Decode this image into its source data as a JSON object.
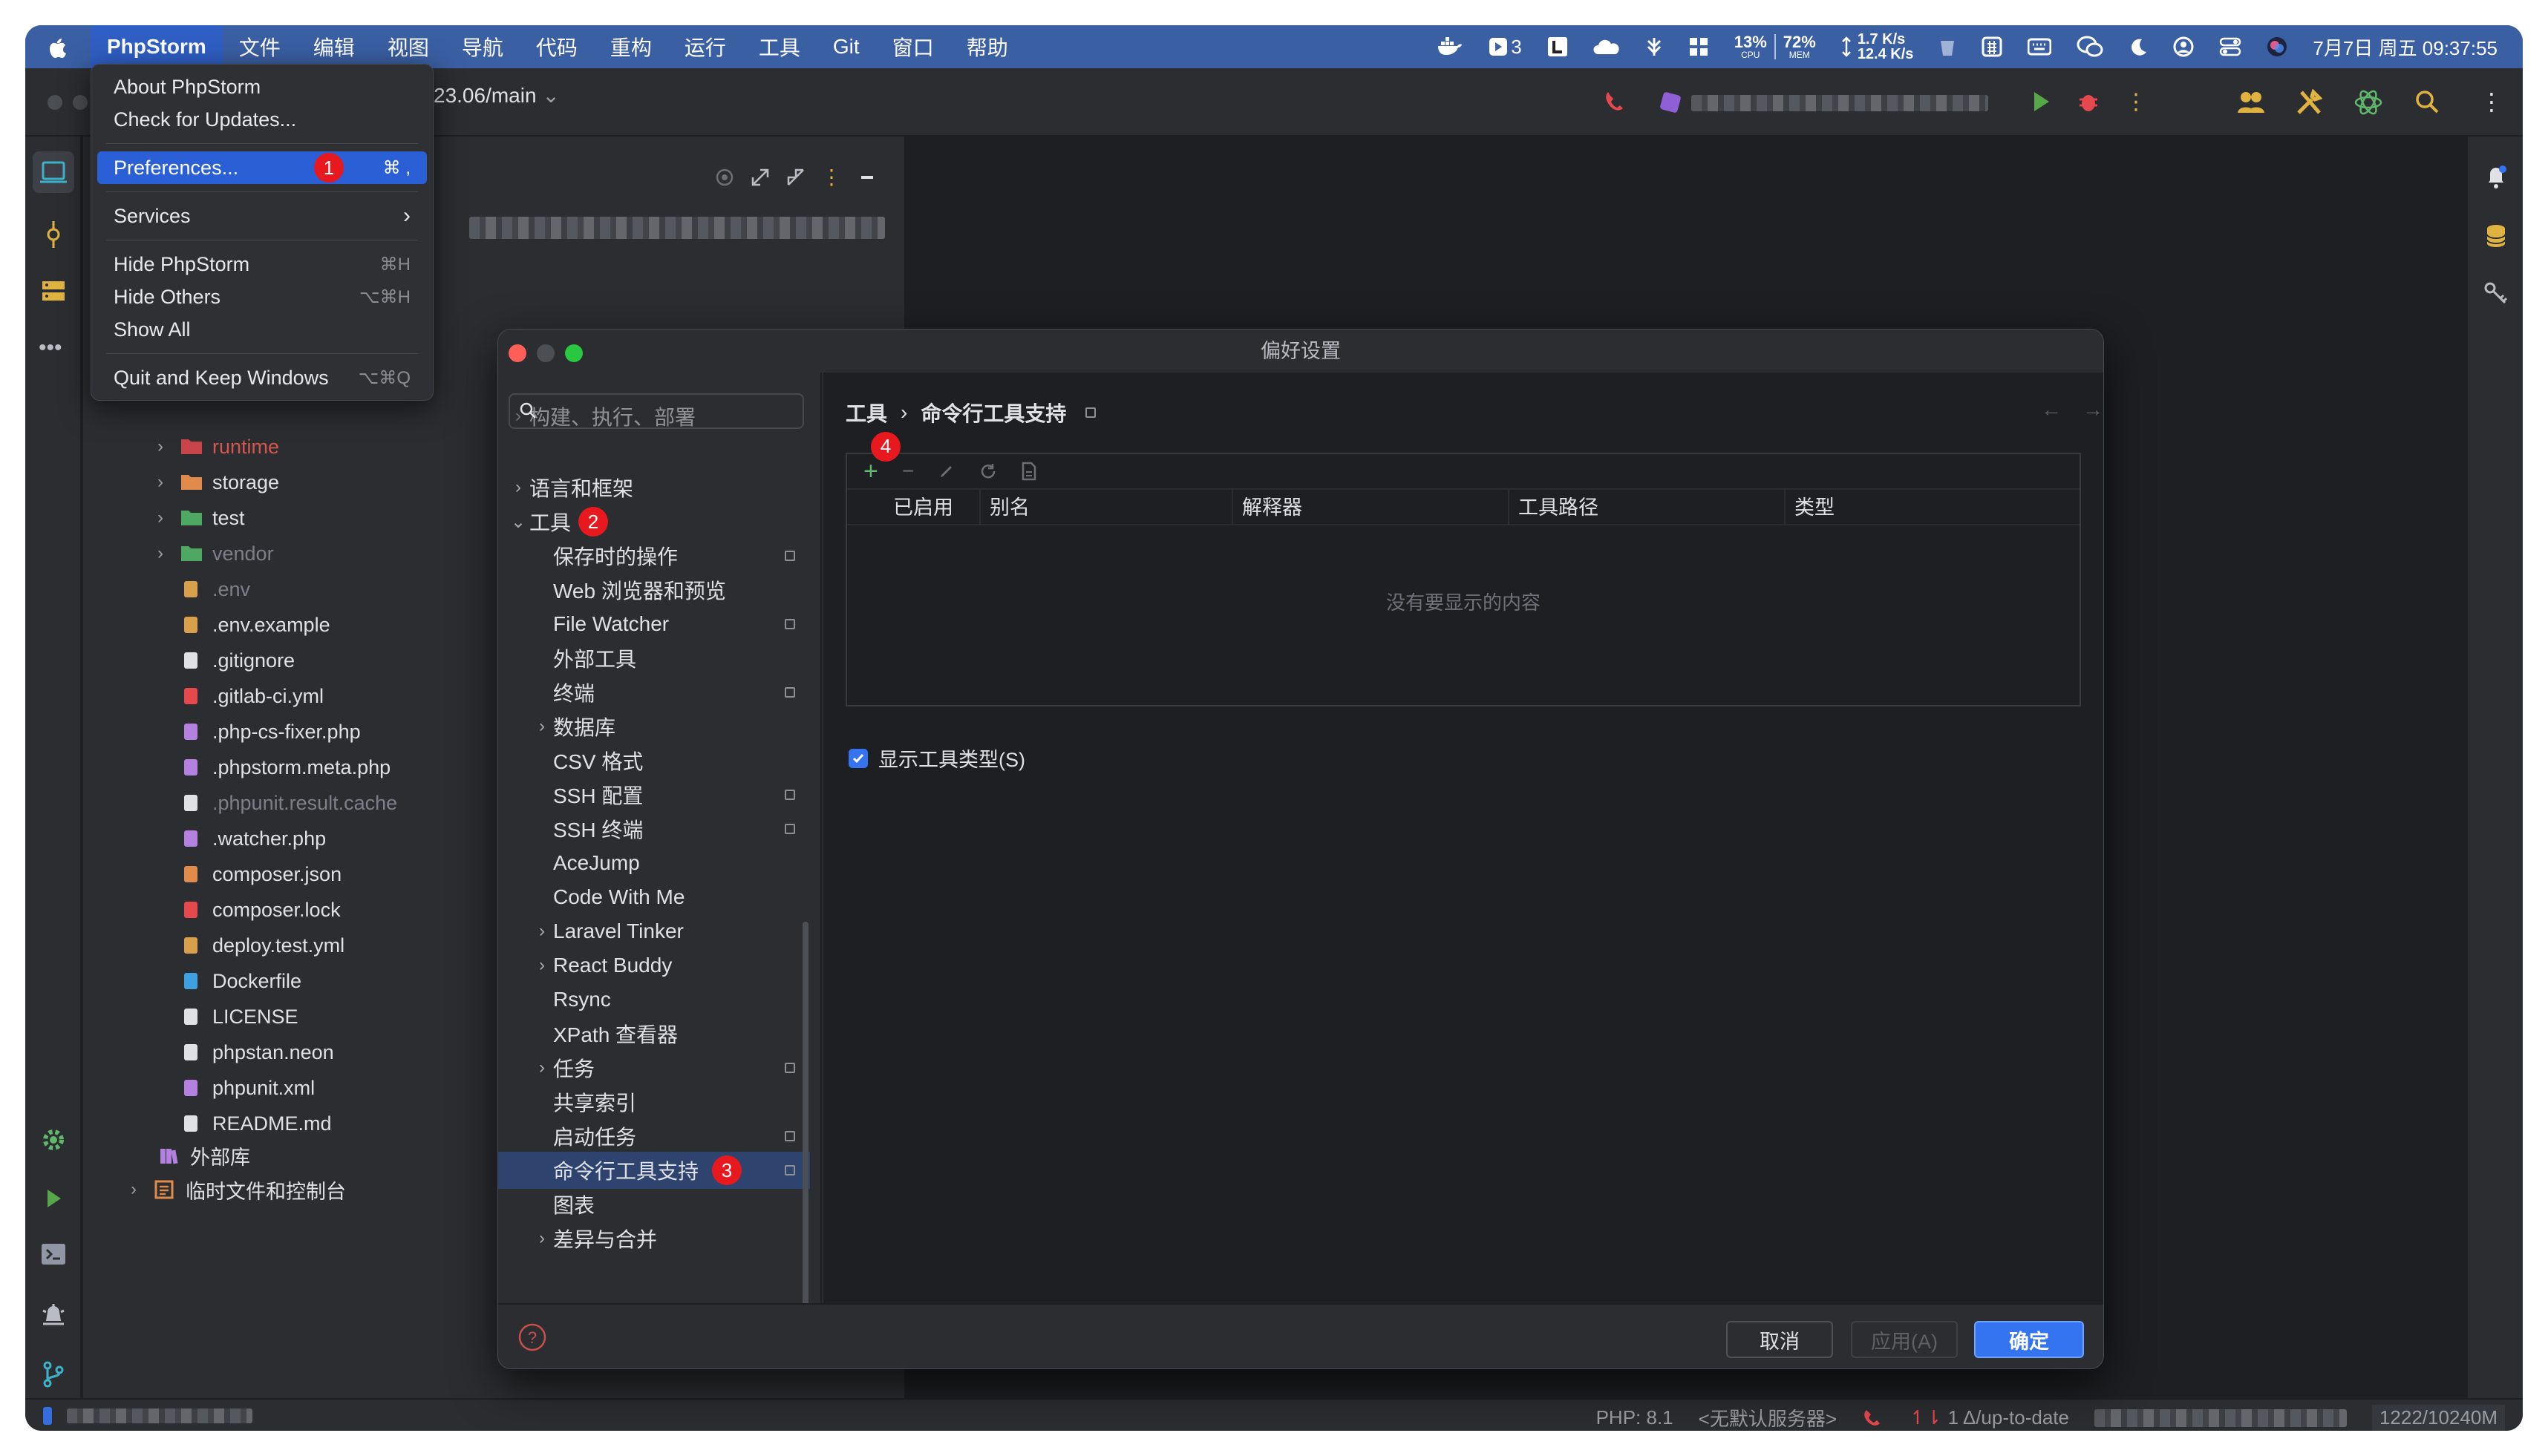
{
  "menubar": {
    "app_name": "PhpStorm",
    "items": [
      "文件",
      "编辑",
      "视图",
      "导航",
      "代码",
      "重构",
      "运行",
      "工具",
      "Git",
      "窗口",
      "帮助"
    ],
    "docker_count": "3",
    "cpu": {
      "value": "13%",
      "label": "CPU"
    },
    "mem": {
      "value": "72%",
      "label": "MEM"
    },
    "net_up": "1.7 K/s",
    "net_down": "12.4 K/s",
    "clock": "7月7日 周五 09:37:55"
  },
  "toolbar": {
    "branch": "23.06/main"
  },
  "app_menu": {
    "about": "About PhpStorm",
    "check_updates": "Check for Updates...",
    "preferences": "Preferences...",
    "preferences_shortcut": "⌘ ,",
    "services": "Services",
    "hide": "Hide PhpStorm",
    "hide_shortcut": "⌘H",
    "hide_others": "Hide Others",
    "hide_others_shortcut": "⌥⌘H",
    "show_all": "Show All",
    "quit": "Quit and Keep Windows",
    "quit_shortcut": "⌥⌘Q"
  },
  "markers": {
    "m1": "1",
    "m2": "2",
    "m3": "3",
    "m4": "4"
  },
  "project_tree": {
    "items": [
      {
        "label": "runtime",
        "kind": "folder-excluded",
        "icon": "folder-icon"
      },
      {
        "label": "storage",
        "kind": "folder",
        "icon": "folder-icon"
      },
      {
        "label": "test",
        "kind": "folder-test",
        "icon": "folder-icon"
      },
      {
        "label": "vendor",
        "kind": "folder-vendor",
        "icon": "folder-icon"
      },
      {
        "label": ".env",
        "kind": "file-dim",
        "icon": "env-icon"
      },
      {
        "label": ".env.example",
        "kind": "file",
        "icon": "env-icon"
      },
      {
        "label": ".gitignore",
        "kind": "file",
        "icon": "gitignore-icon"
      },
      {
        "label": ".gitlab-ci.yml",
        "kind": "file",
        "icon": "gitlab-icon"
      },
      {
        "label": ".php-cs-fixer.php",
        "kind": "file",
        "icon": "php-icon"
      },
      {
        "label": ".phpstorm.meta.php",
        "kind": "file",
        "icon": "php-icon"
      },
      {
        "label": ".phpunit.result.cache",
        "kind": "file-dim",
        "icon": "text-file-icon"
      },
      {
        "label": ".watcher.php",
        "kind": "file",
        "icon": "php-icon"
      },
      {
        "label": "composer.json",
        "kind": "file",
        "icon": "composer-icon"
      },
      {
        "label": "composer.lock",
        "kind": "file",
        "icon": "lock-icon"
      },
      {
        "label": "deploy.test.yml",
        "kind": "file",
        "icon": "yaml-icon"
      },
      {
        "label": "Dockerfile",
        "kind": "file",
        "icon": "docker-icon"
      },
      {
        "label": "LICENSE",
        "kind": "file",
        "icon": "license-icon"
      },
      {
        "label": "phpstan.neon",
        "kind": "file",
        "icon": "neon-icon"
      },
      {
        "label": "phpunit.xml",
        "kind": "file",
        "icon": "phpunit-icon"
      },
      {
        "label": "README.md",
        "kind": "file",
        "icon": "markdown-icon"
      }
    ],
    "external_libs": "外部库",
    "scratches": "临时文件和控制台"
  },
  "prefs": {
    "title": "偏好设置",
    "search_placeholder": "",
    "nav": [
      {
        "label": "构建、执行、部署",
        "chevron": true,
        "indent": 0,
        "pinned": false,
        "partial": true
      },
      {
        "label": "语言和框架",
        "chevron": true,
        "indent": 0,
        "pinned": false
      },
      {
        "label": "工具",
        "chevron": "open",
        "indent": 0,
        "pinned": false
      },
      {
        "label": "保存时的操作",
        "chevron": false,
        "indent": 1,
        "pinned": true
      },
      {
        "label": "Web 浏览器和预览",
        "chevron": false,
        "indent": 1,
        "pinned": false
      },
      {
        "label": "File Watcher",
        "chevron": false,
        "indent": 1,
        "pinned": true
      },
      {
        "label": "外部工具",
        "chevron": false,
        "indent": 1,
        "pinned": false
      },
      {
        "label": "终端",
        "chevron": false,
        "indent": 1,
        "pinned": true
      },
      {
        "label": "数据库",
        "chevron": true,
        "indent": 1,
        "pinned": false
      },
      {
        "label": "CSV 格式",
        "chevron": false,
        "indent": 1,
        "pinned": false
      },
      {
        "label": "SSH 配置",
        "chevron": false,
        "indent": 1,
        "pinned": true
      },
      {
        "label": "SSH 终端",
        "chevron": false,
        "indent": 1,
        "pinned": true
      },
      {
        "label": "AceJump",
        "chevron": false,
        "indent": 1,
        "pinned": false
      },
      {
        "label": "Code With Me",
        "chevron": false,
        "indent": 1,
        "pinned": false
      },
      {
        "label": "Laravel Tinker",
        "chevron": true,
        "indent": 1,
        "pinned": false
      },
      {
        "label": "React Buddy",
        "chevron": true,
        "indent": 1,
        "pinned": false
      },
      {
        "label": "Rsync",
        "chevron": false,
        "indent": 1,
        "pinned": false
      },
      {
        "label": "XPath 查看器",
        "chevron": false,
        "indent": 1,
        "pinned": false
      },
      {
        "label": "任务",
        "chevron": true,
        "indent": 1,
        "pinned": true
      },
      {
        "label": "共享索引",
        "chevron": false,
        "indent": 1,
        "pinned": false
      },
      {
        "label": "启动任务",
        "chevron": false,
        "indent": 1,
        "pinned": true
      },
      {
        "label": "命令行工具支持",
        "chevron": false,
        "indent": 1,
        "pinned": true,
        "selected": true
      },
      {
        "label": "图表",
        "chevron": false,
        "indent": 1,
        "pinned": false
      },
      {
        "label": "差异与合并",
        "chevron": true,
        "indent": 1,
        "pinned": false
      }
    ],
    "crumb_parent": "工具",
    "crumb_sep": "›",
    "crumb_current": "命令行工具支持",
    "table_headers": [
      "已启用",
      "别名",
      "解释器",
      "工具路径",
      "类型"
    ],
    "empty_text": "没有要显示的内容",
    "show_type_label": "显示工具类型(S)",
    "show_type_checked": true,
    "cancel": "取消",
    "apply": "应用(A)",
    "ok": "确定"
  },
  "statusbar": {
    "php": "PHP: 8.1",
    "server": "<无默认服务器>",
    "vcs": "1 Δ/up-to-date",
    "memory": "1222/10240M"
  },
  "colors": {
    "accent": "#3574f0",
    "selection": "#2e436e",
    "marker": "#e8191e",
    "menubar": "#3a5fa3"
  }
}
